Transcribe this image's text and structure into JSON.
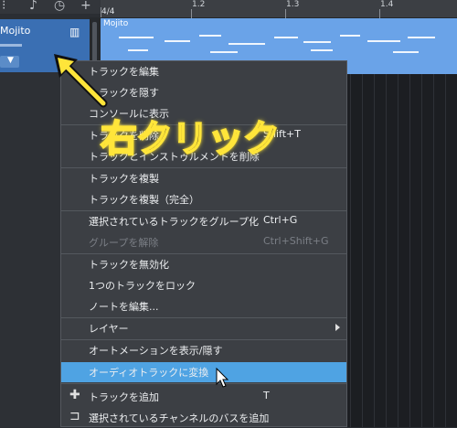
{
  "ruler": {
    "time_signature": "4/4",
    "ticks": [
      "1.2",
      "1.3",
      "1.4"
    ]
  },
  "track": {
    "name": "Mojito",
    "lane_label": "Mojito"
  },
  "annotation": {
    "callout_text": "右クリック"
  },
  "menu": {
    "items": [
      {
        "label": "トラックを編集"
      },
      {
        "label": "トラックを隠す"
      },
      {
        "label": "コンソールに表示"
      },
      {
        "label": "トラックを削除",
        "shortcut": "Shift+T"
      },
      {
        "label": "トラックとインストゥルメントを削除"
      },
      {
        "label": "トラックを複製"
      },
      {
        "label": "トラックを複製（完全）"
      },
      {
        "label": "選択されているトラックをグループ化",
        "shortcut": "Ctrl+G"
      },
      {
        "label": "グループを解除",
        "shortcut": "Ctrl+Shift+G",
        "disabled": true
      },
      {
        "label": "トラックを無効化"
      },
      {
        "label": "1つのトラックをロック"
      },
      {
        "label": "ノートを編集..."
      },
      {
        "label": "レイヤー",
        "submenu": true
      },
      {
        "label": "オートメーションを表示/隠す"
      },
      {
        "label": "オーディオトラックに変換",
        "highlighted": true
      },
      {
        "label": "トラックを追加",
        "shortcut": "T",
        "icon": "plus-icon"
      },
      {
        "label": "選択されているチャンネルのバスを追加",
        "icon": "bus-icon"
      }
    ]
  },
  "colors": {
    "track_header": "#3a6fb3",
    "lane": "#6aa3e8",
    "menu_bg": "#3c3f44",
    "highlight": "#4fa3e3",
    "callout": "#ffe53a"
  }
}
